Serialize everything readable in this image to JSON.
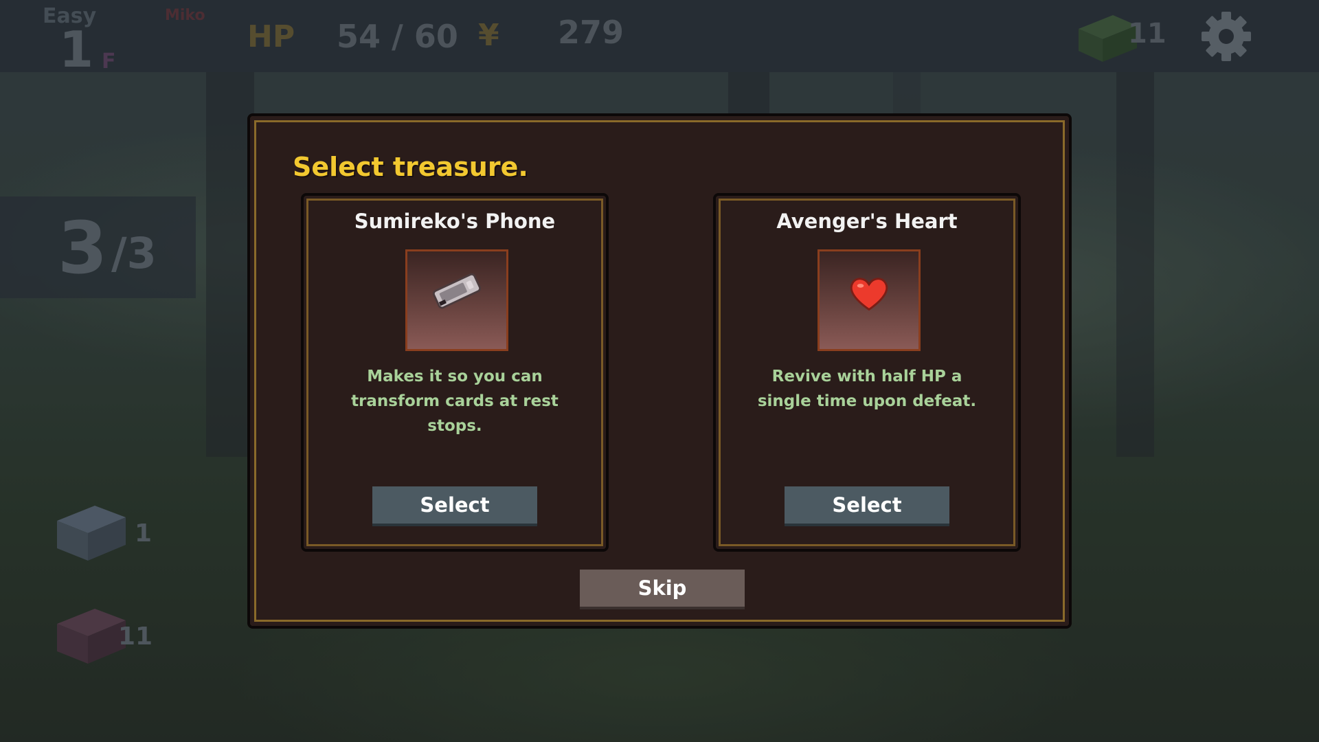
{
  "hud": {
    "difficulty": "Easy",
    "character": "Miko",
    "floor": "1",
    "floor_unit": "F",
    "hp_label": "HP",
    "hp_value": "54 / 60",
    "currency_symbol": "¥",
    "money": "279",
    "deck_count": "11"
  },
  "side": {
    "energy_current": "3",
    "energy_max": "/3",
    "draw_pile_count": "1",
    "discard_pile_count": "11"
  },
  "modal": {
    "title": "Select treasure.",
    "options": [
      {
        "name": "Sumireko's Phone",
        "icon": "phone-icon",
        "description": "Makes it so you can transform cards at rest stops.",
        "button": "Select"
      },
      {
        "name": "Avenger's Heart",
        "icon": "heart-icon",
        "description": "Revive with half HP a single time upon defeat.",
        "button": "Select"
      }
    ],
    "skip_label": "Skip"
  },
  "colors": {
    "title": "#f2c830",
    "description": "#a9d29a",
    "select_button": "#4c5a62",
    "skip_button": "#6a5c58",
    "border_gold": "#8a6a2a"
  }
}
